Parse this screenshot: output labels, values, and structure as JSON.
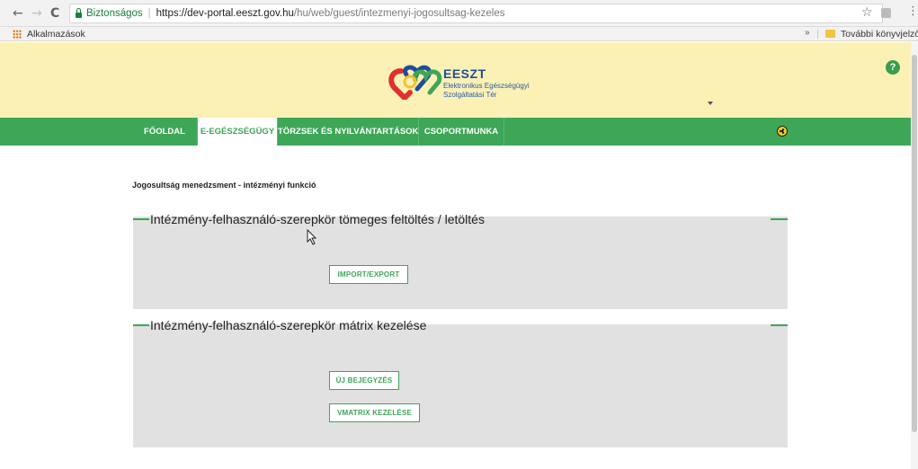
{
  "browser": {
    "back_icon": "←",
    "forward_icon": "→",
    "reload_icon": "C",
    "secure_label": "Biztonságos",
    "url_separator": "|",
    "url_scheme_host": "https://dev-portal.eeszt.gov.hu",
    "url_path": "/hu/web/guest/intezmenyi-jogosultsag-kezeles",
    "star_icon": "☆",
    "menu_icon": "⋮"
  },
  "bookmarks": {
    "apps_label": "Alkalmazások",
    "more_icon": "»",
    "other_bookmarks_label": "További könyvjelzők"
  },
  "header": {
    "brand_title": "EESZT",
    "brand_sub_line1": "Elektronikus Egészségügyi",
    "brand_sub_line2": "Szolgáltatási Tér",
    "help_icon": "?"
  },
  "nav": {
    "items": [
      {
        "label": "FŐOLDAL"
      },
      {
        "label": "E-EGÉSZSÉGÜGY"
      },
      {
        "label": "TÖRZSEK ÉS NYILVÁNTARTÁSOK"
      },
      {
        "label": "CSOPORTMUNKA"
      }
    ],
    "active_index": 1
  },
  "page": {
    "title": "Jogosultság menedzsment - intézményi funkció"
  },
  "panels": [
    {
      "heading": "Intézmény-felhasználó-szerepkör tömeges feltöltés / letöltés",
      "buttons": [
        {
          "label": "IMPORT/EXPORT"
        }
      ]
    },
    {
      "heading": "Intézmény-felhasználó-szerepkör mátrix kezelése",
      "buttons": [
        {
          "label": "ÚJ BEJEGYZÉS"
        },
        {
          "label": "VMATRIX KEZELÉSE"
        }
      ]
    }
  ],
  "colors": {
    "brand_green": "#3ea657",
    "header_yellow": "#fbf1b5",
    "panel_gray": "#e1e1e1",
    "brand_blue": "#1f4e96"
  }
}
